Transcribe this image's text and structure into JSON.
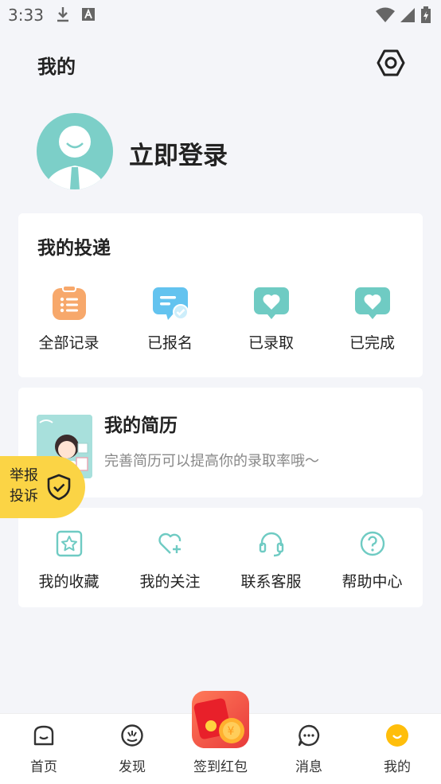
{
  "status": {
    "time": "3:33"
  },
  "header": {
    "title": "我的"
  },
  "profile": {
    "login_label": "立即登录"
  },
  "deliveries": {
    "title": "我的投递",
    "items": [
      {
        "label": "全部记录",
        "icon": "list-icon"
      },
      {
        "label": "已报名",
        "icon": "chat-check-icon"
      },
      {
        "label": "已录取",
        "icon": "heart-bubble-icon"
      },
      {
        "label": "已完成",
        "icon": "heart-bubble-icon"
      }
    ]
  },
  "resume": {
    "title": "我的简历",
    "subtitle": "完善简历可以提高你的录取率哦〜"
  },
  "tools": {
    "items": [
      {
        "label": "我的收藏",
        "icon": "star-icon"
      },
      {
        "label": "我的关注",
        "icon": "heart-plus-icon"
      },
      {
        "label": "联系客服",
        "icon": "headset-icon"
      },
      {
        "label": "帮助中心",
        "icon": "help-icon"
      }
    ]
  },
  "report": {
    "label": "举报投诉"
  },
  "tabbar": {
    "items": [
      {
        "label": "首页",
        "icon": "home-icon"
      },
      {
        "label": "发现",
        "icon": "discover-icon"
      },
      {
        "label": "签到红包",
        "icon": "red-packet-icon"
      },
      {
        "label": "消息",
        "icon": "message-icon"
      },
      {
        "label": "我的",
        "icon": "profile-icon"
      }
    ],
    "active_index": 4
  },
  "colors": {
    "accent_teal": "#78cfc7",
    "accent_orange": "#f7a86b",
    "accent_blue": "#63c3ef",
    "report_yellow": "#fbd445",
    "active_tab": "#ffbe0b",
    "background": "#f4f5f9"
  }
}
